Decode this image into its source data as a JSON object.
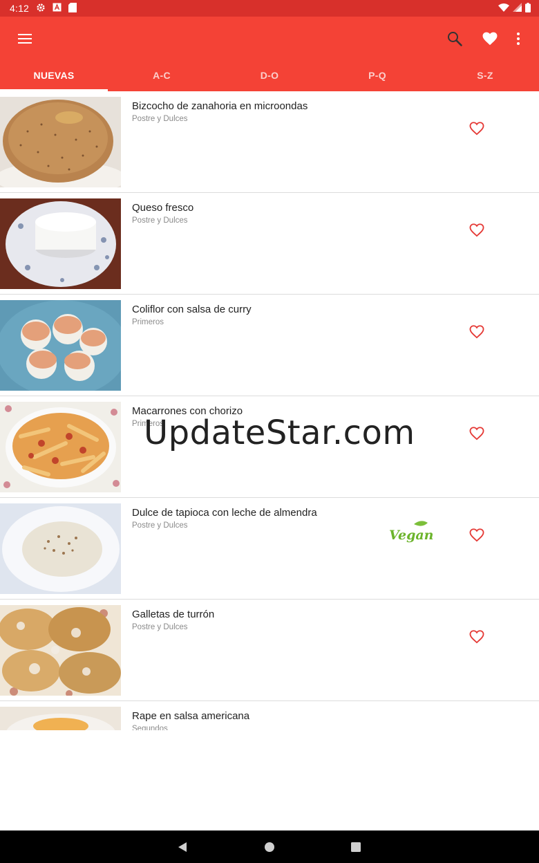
{
  "status_bar": {
    "time": "4:12",
    "left_icons": [
      "settings-icon",
      "a-box-icon",
      "sd-card-icon"
    ],
    "right_icons": [
      "wifi-icon",
      "signal-icon",
      "battery-icon"
    ]
  },
  "app_bar": {
    "color": "#f44236",
    "actions": [
      "search-icon",
      "heart-icon",
      "more-vert-icon"
    ]
  },
  "tabs": [
    "NUEVAS",
    "A-C",
    "D-O",
    "P-Q",
    "S-Z"
  ],
  "active_tab": "NUEVAS",
  "recipes": [
    {
      "title": "Bizcocho de zanahoria en microondas",
      "category": "Postre y Dulces"
    },
    {
      "title": "Queso fresco",
      "category": "Postre y Dulces"
    },
    {
      "title": "Coliflor con salsa de curry",
      "category": "Primeros"
    },
    {
      "title": "Macarrones con chorizo",
      "category": "Primeros"
    },
    {
      "title": "Dulce de tapioca con leche de almendra",
      "category": "Postre y Dulces",
      "badge": "Vegan"
    },
    {
      "title": "Galletas de turrón",
      "category": "Postre y Dulces"
    },
    {
      "title": "Rape en salsa americana",
      "category": "Segundos"
    }
  ],
  "watermark": "UpdateStar.com",
  "nav_bar": [
    "back-icon",
    "home-icon",
    "recents-icon"
  ]
}
